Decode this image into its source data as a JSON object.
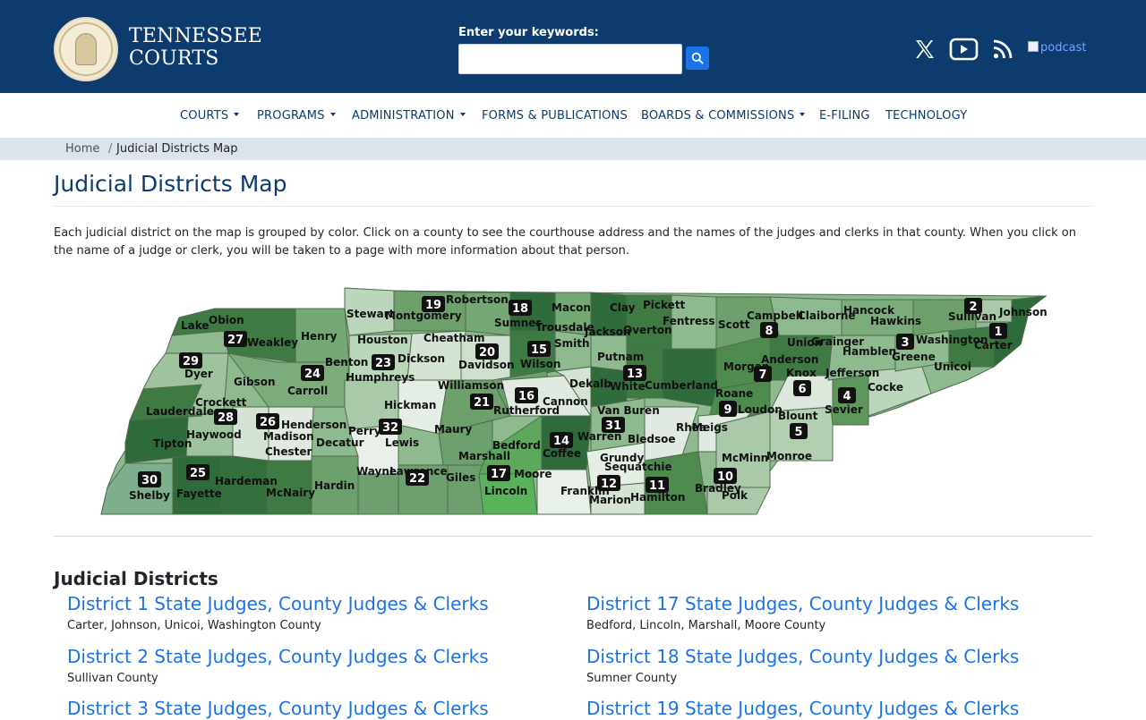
{
  "header": {
    "brand_line1": "TENNESSEE",
    "brand_line2": "COURTS",
    "search_label": "Enter your keywords:",
    "search_value": "",
    "podcast_alt": "podcast",
    "social_icons": [
      "x-icon",
      "youtube-icon",
      "rss-icon"
    ]
  },
  "nav": {
    "items": [
      {
        "label": "COURTS",
        "dropdown": true
      },
      {
        "label": "PROGRAMS",
        "dropdown": true
      },
      {
        "label": "ADMINISTRATION",
        "dropdown": true
      },
      {
        "label": "FORMS & PUBLICATIONS",
        "dropdown": false
      },
      {
        "label": "BOARDS & COMMISSIONS",
        "dropdown": true
      },
      {
        "label": "E-FILING",
        "dropdown": false
      },
      {
        "label": "TECHNOLOGY",
        "dropdown": false
      }
    ]
  },
  "breadcrumb": {
    "home": "Home",
    "separator": "/",
    "current": "Judicial Districts Map"
  },
  "page": {
    "title": "Judicial Districts Map",
    "intro": "Each judicial district on the map is grouped by color. Click on a county to see the courthouse address and the names of the judges and clerks in that county. When you click on the name of a judge or clerk, you will be taken to a page with more information about that person."
  },
  "map": {
    "county_labels": [
      "Lake",
      "Obion",
      "Weakley",
      "Henry",
      "Stewart",
      "Montgomery",
      "Robertson",
      "Sumner",
      "Macon",
      "Clay",
      "Pickett",
      "Trousdale",
      "Jackson",
      "Overton",
      "Fentress",
      "Scott",
      "Campbell",
      "Claiborne",
      "Hancock",
      "Hawkins",
      "Sullivan",
      "Johnson",
      "Carter",
      "Washington",
      "Unicoi",
      "Greene",
      "Hamblen",
      "Grainger",
      "Union",
      "Anderson",
      "Morgan",
      "Knox",
      "Jefferson",
      "Cocke",
      "Sevier",
      "Blount",
      "Loudon",
      "Roane",
      "Cumberland",
      "White",
      "Putnam",
      "Dekalb",
      "Smith",
      "Wilson",
      "Davidson",
      "Cheatham",
      "Houston",
      "Dickson",
      "Humphreys",
      "Benton",
      "Carroll",
      "Gibson",
      "Dyer",
      "Crockett",
      "Lauderdale",
      "Haywood",
      "Tipton",
      "Madison",
      "Henderson",
      "Decatur",
      "Chester",
      "Perry",
      "Hickman",
      "Lewis",
      "Williamson",
      "Rutherford",
      "Cannon",
      "Maury",
      "Marshall",
      "Bedford",
      "Coffee",
      "Warren",
      "Van Buren",
      "Bledsoe",
      "Rhea",
      "Meigs",
      "McMinn",
      "Monroe",
      "Polk",
      "Bradley",
      "Hamilton",
      "Sequatchie",
      "Grundy",
      "Marion",
      "Franklin",
      "Moore",
      "Lincoln",
      "Giles",
      "Lawrence",
      "Wayne",
      "Hardin",
      "McNairy",
      "Hardeman",
      "Fayette",
      "Shelby"
    ],
    "district_numbers": [
      "1",
      "2",
      "3",
      "4",
      "5",
      "6",
      "7",
      "8",
      "9",
      "10",
      "11",
      "12",
      "13",
      "14",
      "15",
      "16",
      "17",
      "18",
      "19",
      "20",
      "21",
      "22",
      "23",
      "24",
      "25",
      "26",
      "27",
      "28",
      "29",
      "30",
      "31",
      "32"
    ]
  },
  "districts": {
    "heading": "Judicial Districts",
    "left": [
      {
        "title": "District 1 State Judges, County Judges & Clerks",
        "counties": "Carter, Johnson, Unicoi, Washington County"
      },
      {
        "title": "District 2 State Judges, County Judges & Clerks",
        "counties": "Sullivan County"
      },
      {
        "title": "District 3 State Judges, County Judges & Clerks",
        "counties": ""
      }
    ],
    "right": [
      {
        "title": "District 17 State Judges, County Judges & Clerks",
        "counties": "Bedford, Lincoln, Marshall, Moore County"
      },
      {
        "title": "District 18 State Judges, County Judges & Clerks",
        "counties": "Sumner County"
      },
      {
        "title": "District 19 State Judges, County Judges & Clerks",
        "counties": ""
      }
    ]
  },
  "colors": {
    "header_bg": "#0d3b6e",
    "link": "#1a73e8",
    "breadcrumb_bg": "#dde3ea"
  }
}
